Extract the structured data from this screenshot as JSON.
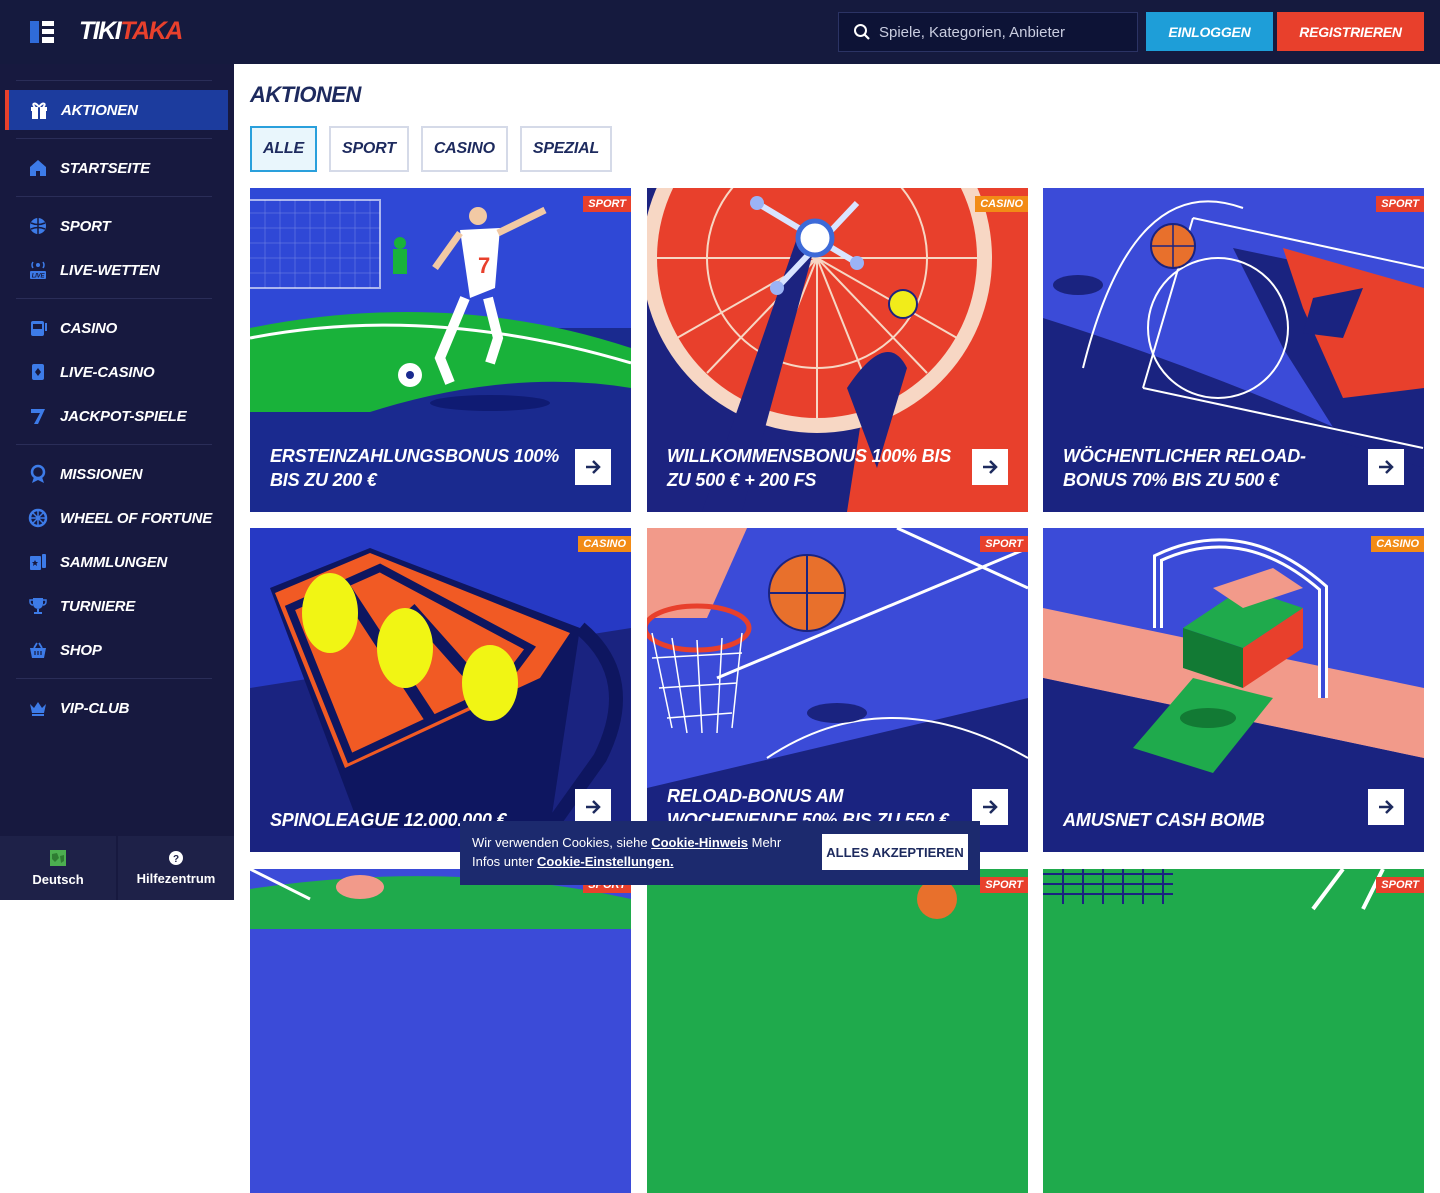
{
  "header": {
    "logo_part1": "TIKI",
    "logo_part2": "TAKA",
    "search_placeholder": "Spiele, Kategorien, Anbieter",
    "login_label": "EINLOGGEN",
    "register_label": "REGISTRIEREN"
  },
  "sidebar": {
    "items": [
      {
        "label": "AKTIONEN",
        "icon": "gift-icon",
        "active": true
      },
      {
        "label": "STARTSEITE",
        "icon": "home-icon"
      },
      {
        "label": "SPORT",
        "icon": "ball-icon"
      },
      {
        "label": "LIVE-WETTEN",
        "icon": "live-icon"
      },
      {
        "label": "CASINO",
        "icon": "slot-machine-icon"
      },
      {
        "label": "LIVE-CASINO",
        "icon": "live-casino-icon"
      },
      {
        "label": "JACKPOT-SPIELE",
        "icon": "seven-icon"
      },
      {
        "label": "MISSIONEN",
        "icon": "missions-icon"
      },
      {
        "label": "WHEEL OF FORTUNE",
        "icon": "wheel-icon"
      },
      {
        "label": "SAMMLUNGEN",
        "icon": "collections-icon"
      },
      {
        "label": "TURNIERE",
        "icon": "trophy-icon"
      },
      {
        "label": "SHOP",
        "icon": "basket-icon"
      },
      {
        "label": "VIP-CLUB",
        "icon": "crown-icon"
      }
    ],
    "footer": {
      "language_label": "Deutsch",
      "help_label": "Hilfezentrum"
    }
  },
  "main": {
    "title": "AKTIONEN",
    "tabs": [
      "ALLE",
      "SPORT",
      "CASINO",
      "SPEZIAL"
    ],
    "active_tab": "ALLE",
    "cards": [
      {
        "title": "ERSTEINZAHLUNGSBONUS 100% BIS ZU 200 €",
        "badge": "SPORT"
      },
      {
        "title": "WILLKOMMENSBONUS 100% BIS ZU 500 € + 200 FS",
        "badge": "CASINO"
      },
      {
        "title": "WÖCHENTLICHER RELOAD-BONUS 70% BIS ZU 500 €",
        "badge": "SPORT"
      },
      {
        "title": "SPINOLEAGUE 12.000.000 €",
        "badge": "CASINO"
      },
      {
        "title": "RELOAD-BONUS AM WOCHENENDE 50% BIS ZU 550 €",
        "badge": "SPORT"
      },
      {
        "title": "AMUSNET CASH BOMB",
        "badge": "CASINO"
      },
      {
        "title": "",
        "badge": "SPORT"
      },
      {
        "title": "",
        "badge": "SPORT"
      },
      {
        "title": "",
        "badge": "SPORT"
      }
    ]
  },
  "cookie": {
    "text_1": "Wir verwenden Cookies, siehe ",
    "link_1": "Cookie-Hinweis",
    "text_2": " Mehr Infos unter ",
    "link_2": "Cookie-Einstellungen.",
    "accept_label": "ALLES AKZEPTIEREN"
  },
  "colors": {
    "header_bg": "#151a3e",
    "sidebar_bg": "#17193f",
    "accent_red": "#e8402c",
    "accent_blue": "#1e9ed8",
    "active_nav": "#1c3c9e",
    "card_blue": "#3d4fe0"
  }
}
